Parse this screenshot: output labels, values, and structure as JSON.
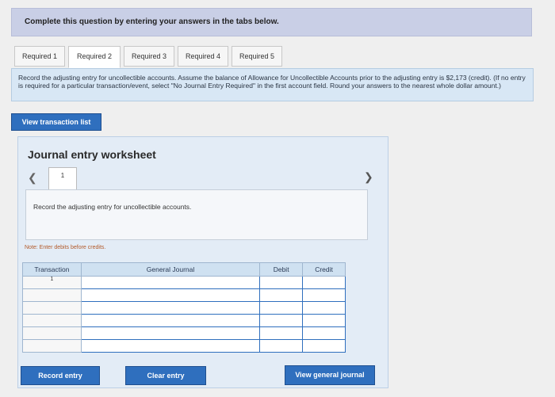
{
  "banner": {
    "text": "Complete this question by entering your answers in the tabs below."
  },
  "tabs": [
    {
      "label": "Required 1"
    },
    {
      "label": "Required 2"
    },
    {
      "label": "Required 3"
    },
    {
      "label": "Required 4"
    },
    {
      "label": "Required 5"
    }
  ],
  "active_tab": "Required 2",
  "instruction": "Record the adjusting entry for uncollectible accounts. Assume the balance of Allowance for Uncollectible Accounts prior to the adjusting entry is $2,173 (credit). (If no entry is required for a particular transaction/event, select \"No Journal Entry Required\" in the first account field. Round your answers to the nearest whole dollar amount.)",
  "view_transaction_list_label": "View transaction list",
  "worksheet": {
    "title": "Journal entry worksheet",
    "prev_icon": "chevron-left-icon",
    "next_icon": "chevron-right-icon",
    "step": "1",
    "entry_description": "Record the adjusting entry for uncollectible accounts.",
    "note": "Note: Enter debits before credits."
  },
  "journal": {
    "headers": [
      "Transaction",
      "General Journal",
      "Debit",
      "Credit"
    ],
    "rows": [
      {
        "transaction": "1",
        "account": "",
        "debit": "",
        "credit": ""
      },
      {
        "transaction": "",
        "account": "",
        "debit": "",
        "credit": ""
      },
      {
        "transaction": "",
        "account": "",
        "debit": "",
        "credit": ""
      },
      {
        "transaction": "",
        "account": "",
        "debit": "",
        "credit": ""
      },
      {
        "transaction": "",
        "account": "",
        "debit": "",
        "credit": ""
      },
      {
        "transaction": "",
        "account": "",
        "debit": "",
        "credit": ""
      }
    ]
  },
  "buttons": {
    "record_entry": "Record entry",
    "clear_entry": "Clear entry",
    "view_general_journal": "View general journal"
  },
  "colors": {
    "accent": "#2f6fbe",
    "banner": "#c9cfe6",
    "instruction_bg": "#d8e7f5"
  }
}
